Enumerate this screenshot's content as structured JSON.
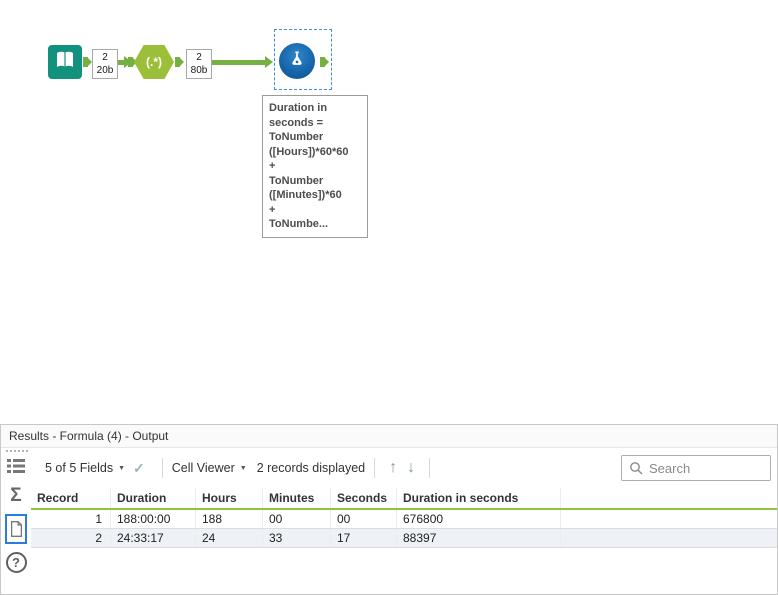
{
  "canvas": {
    "regex_label": "(.*)",
    "connection1": {
      "records": "2",
      "size": "20b"
    },
    "connection2": {
      "records": "2",
      "size": "80b"
    },
    "formula_annotation": "Duration in\nseconds =\nToNumber\n([Hours])*60*60\n+\nToNumber\n([Minutes])*60\n+\nToNumbe..."
  },
  "icons": {
    "caret": "▼",
    "check": "✓",
    "nav_up": "↑",
    "nav_down": "↓",
    "sigma": "Σ",
    "help": "?"
  },
  "colors": {
    "connection_green": "#76b043",
    "input_teal": "#12917f",
    "regex_green": "#9cbf3a",
    "formula_blue": "#1766ac",
    "header_underline_green": "#8cc63f",
    "selection_blue": "#3f8edb"
  },
  "results": {
    "title": "Results - Formula (4) - Output",
    "toolbar": {
      "fields": "5 of 5 Fields",
      "cell_viewer": "Cell Viewer",
      "records": "2 records displayed",
      "search_placeholder": "Search"
    },
    "table": {
      "columns": [
        "Record",
        "Duration",
        "Hours",
        "Minutes",
        "Seconds",
        "Duration in seconds"
      ],
      "rows": [
        [
          "1",
          "188:00:00",
          "188",
          "00",
          "00",
          "676800"
        ],
        [
          "2",
          "24:33:17",
          "24",
          "33",
          "17",
          "88397"
        ]
      ]
    }
  }
}
